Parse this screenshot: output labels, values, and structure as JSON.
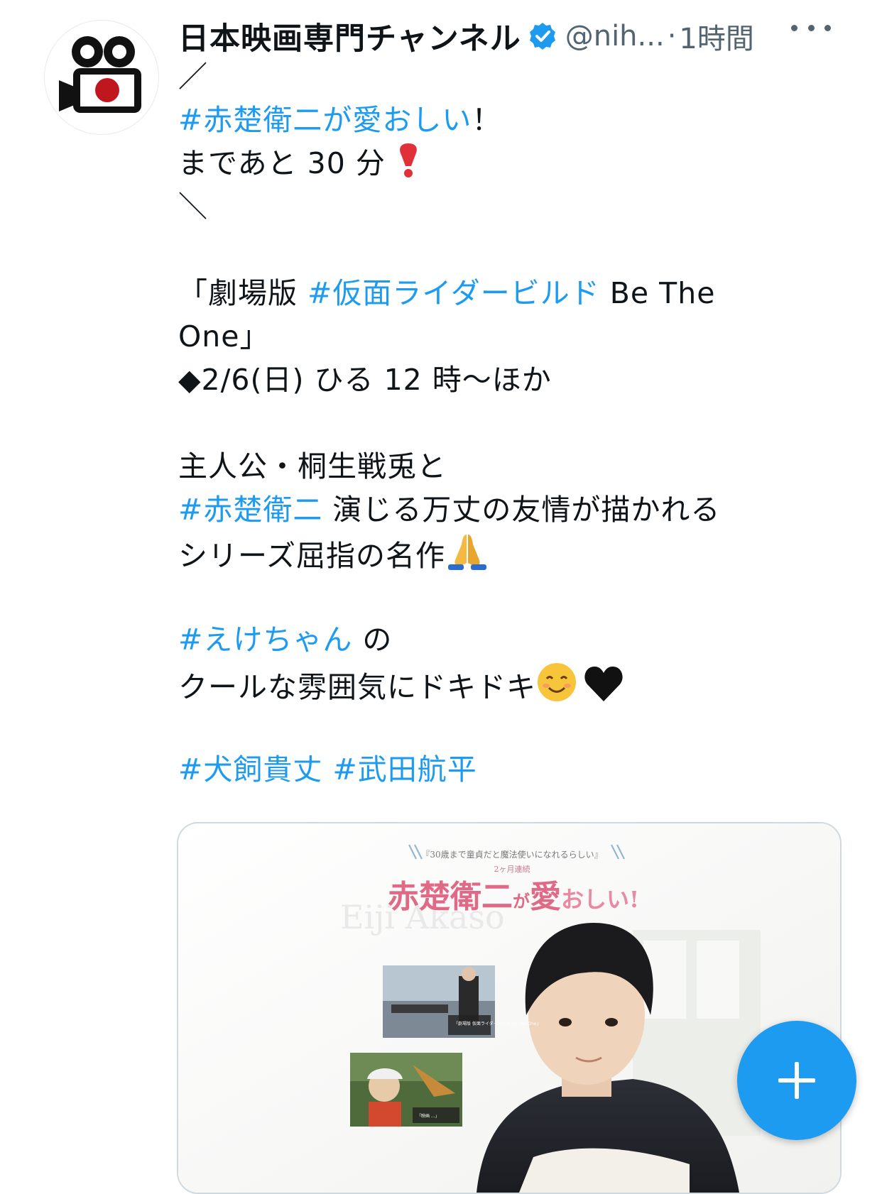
{
  "tweet": {
    "author": {
      "display_name": "日本映画専門チャンネル",
      "handle": "@nih...",
      "avatar_icon": "film-camera-icon",
      "verified_icon": "verified-badge-icon"
    },
    "separator": "·",
    "time": "1時間",
    "more_icon": "more-horizontal-icon",
    "text": {
      "l1": "／",
      "l2_hashtag": "#赤楚衛二が愛おしい",
      "l2_rest": "！",
      "l3": "まであと 30 分",
      "l3_emoji": "heavy-exclamation-icon",
      "l4": "＼",
      "l6_pre": "「劇場版 ",
      "l6_hashtag": "#仮面ライダービルド",
      "l6_post": " Be The",
      "l7": "One」",
      "l8": "◆2/6(日) ひる 12 時〜ほか",
      "l10": "主人公・桐生戦兎と",
      "l11_hashtag": "#赤楚衛二",
      "l11_rest": " 演じる万丈の友情が描かれる",
      "l12": "シリーズ屈指の名作",
      "l12_emoji": "folded-hands-icon",
      "l14_hashtag": "#えけちゃん",
      "l14_rest": " の",
      "l15": "クールな雰囲気にドキドキ",
      "l15_emoji1": "smiling-face-icon",
      "l15_emoji2": "black-heart-icon",
      "l17_hashtag1": "#犬飼貴丈",
      "l17_hashtag2": "#武田航平"
    },
    "media": {
      "header_small_1": "『30歳まで童貞だと魔法使いになれるらしい』",
      "header_small_2": "2ヶ月連続",
      "title_red": "赤楚衛二",
      "title_small": "が",
      "title_red2": "愛",
      "title_pink": "おしい!",
      "watermark": "Eiji Akaso",
      "thumb1_caption": "「劇場版 仮面ライダービルド Be The One」",
      "thumb2_caption": "「映画 ...」"
    }
  },
  "fab": {
    "icon": "plus-icon",
    "color": "#1d9bf0"
  },
  "colors": {
    "hashtag": "#1d9bf0",
    "text": "#0f1419",
    "secondary": "#536471"
  }
}
